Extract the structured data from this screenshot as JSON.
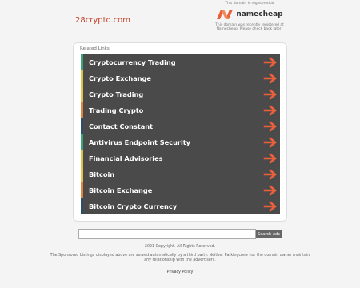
{
  "header": {
    "domain": "28crypto.com",
    "registrar_note_top": "This domain is registered at",
    "registrar_name": "namecheap",
    "registrar_note_bottom": "This domain was recently registered at Namecheap. Please check back later!"
  },
  "related": {
    "label": "Related Links",
    "links": [
      {
        "label": "Cryptocurrency Trading",
        "color": "#3aa57a"
      },
      {
        "label": "Crypto Exchange",
        "color": "#d9c34a"
      },
      {
        "label": "Crypto Trading",
        "color": "#e8c14c"
      },
      {
        "label": "Trading Crypto",
        "color": "#e0843c"
      },
      {
        "label": "Contact Constant",
        "color": "#2a4f66"
      },
      {
        "label": "Antivirus Endpoint Security",
        "color": "#3aa57a"
      },
      {
        "label": "Financial Advisories",
        "color": "#d9c34a"
      },
      {
        "label": "Bitcoin",
        "color": "#e8c14c"
      },
      {
        "label": "Bitcoin Exchange",
        "color": "#e0843c"
      },
      {
        "label": "Bitcoin Crypto Currency",
        "color": "#2a4f66"
      }
    ]
  },
  "search": {
    "placeholder": "",
    "button_label": "Search Ads"
  },
  "footer": {
    "copyright": "2021 Copyright. All Rights Reserved.",
    "disclaimer": "The Sponsored Listings displayed above are served automatically by a third party. Neither Parkingcrew nor the domain owner maintain any relationship with the advertisers.",
    "privacy": "Privacy Policy"
  },
  "colors": {
    "arrow": "#e8603c",
    "row_bg": "#4a4a4a",
    "brand_orange": "#e8603c"
  }
}
